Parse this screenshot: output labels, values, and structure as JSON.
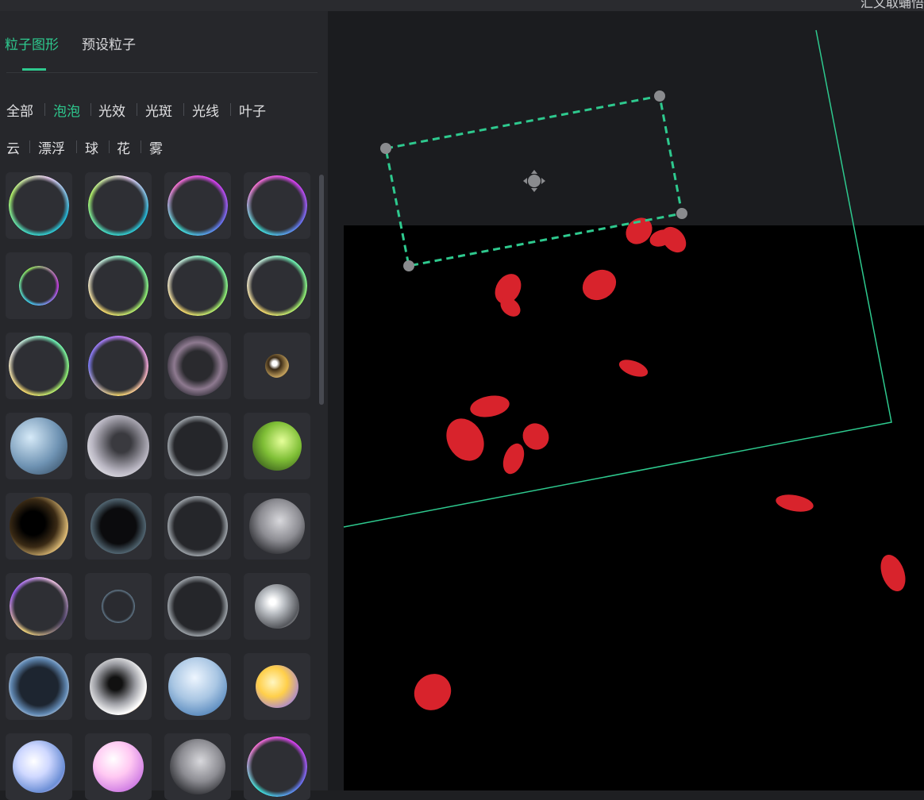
{
  "window": {
    "corner_text": "汇文取蛹悟"
  },
  "tabs": [
    {
      "label": "粒子图形",
      "active": true
    },
    {
      "label": "预设粒子",
      "active": false
    }
  ],
  "categories_row1": [
    {
      "label": "全部",
      "active": false
    },
    {
      "label": "泡泡",
      "active": true
    },
    {
      "label": "光效",
      "active": false
    },
    {
      "label": "光斑",
      "active": false
    },
    {
      "label": "光线",
      "active": false
    },
    {
      "label": "叶子",
      "active": false
    }
  ],
  "categories_row2": [
    {
      "label": "云",
      "active": false
    },
    {
      "label": "漂浮",
      "active": false
    },
    {
      "label": "球",
      "active": false
    },
    {
      "label": "花",
      "active": false
    },
    {
      "label": "雾",
      "active": false
    }
  ],
  "colors": {
    "accent": "#2ec98e",
    "panel": "#26272b",
    "stage": "#000000",
    "petal": "#d8232c"
  },
  "bubbles": [
    {
      "style": "rainbow-cyan"
    },
    {
      "style": "rainbow-cyan"
    },
    {
      "style": "rainbow-magenta"
    },
    {
      "style": "rainbow-magenta"
    },
    {
      "style": "small-rainbow"
    },
    {
      "style": "rainbow-green"
    },
    {
      "style": "rainbow-green"
    },
    {
      "style": "rainbow-green"
    },
    {
      "style": "rainbow-green"
    },
    {
      "style": "rainbow-purple"
    },
    {
      "style": "smoky"
    },
    {
      "style": "tiny-dark"
    },
    {
      "style": "blue-glass"
    },
    {
      "style": "white-glass"
    },
    {
      "style": "clear-ring"
    },
    {
      "style": "green-glow"
    },
    {
      "style": "dark-gold"
    },
    {
      "style": "dark-sparkle"
    },
    {
      "style": "clear-ring"
    },
    {
      "style": "grey-glass"
    },
    {
      "style": "purple-dark"
    },
    {
      "style": "faint-ring"
    },
    {
      "style": "clear-ring"
    },
    {
      "style": "star-sparkle"
    },
    {
      "style": "blue-crystal"
    },
    {
      "style": "silver-rainbow"
    },
    {
      "style": "blue-solid"
    },
    {
      "style": "gold-holo"
    },
    {
      "style": "holo-pearl"
    },
    {
      "style": "pink-pearl"
    },
    {
      "style": "grey-glass"
    },
    {
      "style": "rainbow-magenta"
    }
  ],
  "petal_count": 14
}
